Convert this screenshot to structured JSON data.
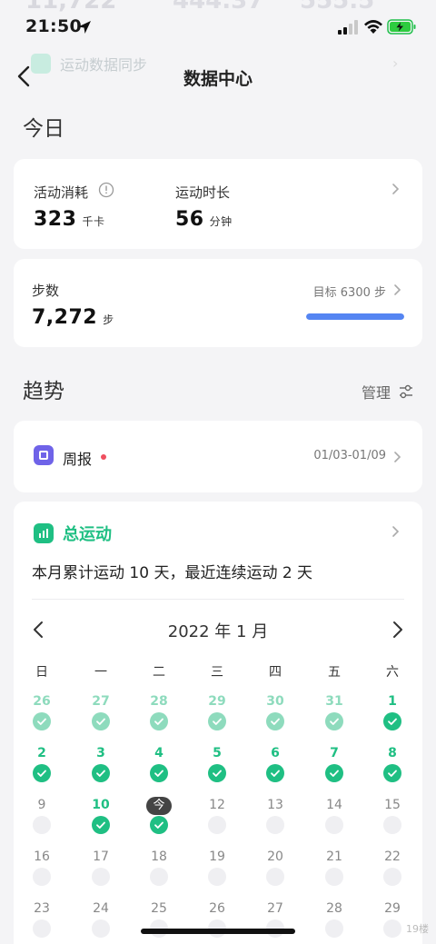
{
  "status": {
    "time": "21:50"
  },
  "nav": {
    "title": "数据中心",
    "ghost_label": "运动数据同步"
  },
  "today": {
    "section_title": "今日",
    "calories": {
      "label": "活动消耗",
      "value": "323",
      "unit": "千卡"
    },
    "duration": {
      "label": "运动时长",
      "value": "56",
      "unit": "分钟"
    },
    "steps": {
      "label": "步数",
      "value": "7,272",
      "unit": "步",
      "goal_text": "目标 6300 步",
      "progress": 1.0
    }
  },
  "trend": {
    "section_title": "趋势",
    "manage_label": "管理",
    "weekly": {
      "label": "周报",
      "range": "01/03-01/09"
    },
    "total": {
      "title": "总运动",
      "summary": "本月累计运动 10 天，最近连续运动 2 天",
      "month_label": "2022 年 1 月",
      "weekdays": [
        "日",
        "一",
        "二",
        "三",
        "四",
        "五",
        "六"
      ],
      "weeks": [
        [
          {
            "d": "26",
            "s": "faded"
          },
          {
            "d": "27",
            "s": "faded"
          },
          {
            "d": "28",
            "s": "faded"
          },
          {
            "d": "29",
            "s": "faded"
          },
          {
            "d": "30",
            "s": "faded"
          },
          {
            "d": "31",
            "s": "faded"
          },
          {
            "d": "1",
            "s": "done"
          }
        ],
        [
          {
            "d": "2",
            "s": "done"
          },
          {
            "d": "3",
            "s": "done"
          },
          {
            "d": "4",
            "s": "done"
          },
          {
            "d": "5",
            "s": "done"
          },
          {
            "d": "6",
            "s": "done"
          },
          {
            "d": "7",
            "s": "done"
          },
          {
            "d": "8",
            "s": "done"
          }
        ],
        [
          {
            "d": "9",
            "s": "empty"
          },
          {
            "d": "10",
            "s": "done"
          },
          {
            "d": "今",
            "s": "today"
          },
          {
            "d": "12",
            "s": "empty"
          },
          {
            "d": "13",
            "s": "empty"
          },
          {
            "d": "14",
            "s": "empty"
          },
          {
            "d": "15",
            "s": "empty"
          }
        ],
        [
          {
            "d": "16",
            "s": "empty"
          },
          {
            "d": "17",
            "s": "empty"
          },
          {
            "d": "18",
            "s": "empty"
          },
          {
            "d": "19",
            "s": "empty"
          },
          {
            "d": "20",
            "s": "empty"
          },
          {
            "d": "21",
            "s": "empty"
          },
          {
            "d": "22",
            "s": "empty"
          }
        ],
        [
          {
            "d": "23",
            "s": "empty"
          },
          {
            "d": "24",
            "s": "empty"
          },
          {
            "d": "25",
            "s": "empty"
          },
          {
            "d": "26",
            "s": "empty"
          },
          {
            "d": "27",
            "s": "empty"
          },
          {
            "d": "28",
            "s": "empty"
          },
          {
            "d": "29",
            "s": "empty"
          }
        ]
      ]
    }
  },
  "colors": {
    "accent_green": "#1fbf83",
    "faded_green": "#8edbbd",
    "progress_blue": "#5585f2",
    "week_icon_purple": "#6f63e8",
    "alert_red": "#ef4f5f"
  },
  "watermark": "19楼"
}
